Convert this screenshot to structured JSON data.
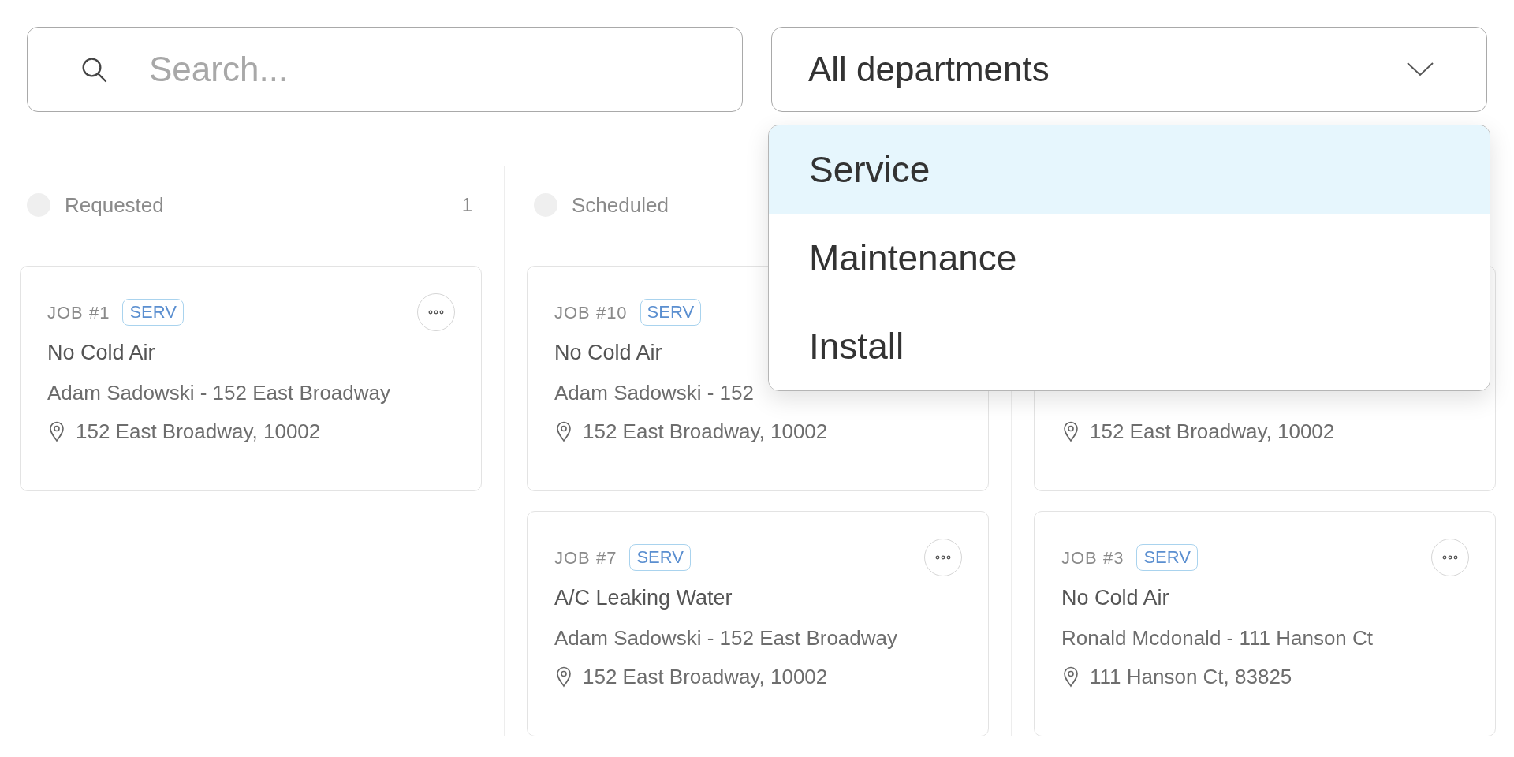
{
  "search": {
    "placeholder": "Search..."
  },
  "department_select": {
    "value": "All departments",
    "expanded": true,
    "options": [
      {
        "label": "Service",
        "selected": true
      },
      {
        "label": "Maintenance",
        "selected": false
      },
      {
        "label": "Install",
        "selected": false
      }
    ]
  },
  "columns": [
    {
      "title": "Requested",
      "count": "1",
      "cards": [
        {
          "job": "JOB #1",
          "tag": "SERV",
          "menu": true,
          "title": "No Cold Air",
          "customer": "Adam Sadowski - 152 East Broadway",
          "location": "152 East Broadway, 10002"
        }
      ]
    },
    {
      "title": "Scheduled",
      "cards": [
        {
          "job": "JOB #10",
          "tag": "SERV",
          "title": "No Cold Air",
          "customer": "Adam Sadowski - 152",
          "location": "152 East Broadway, 10002"
        },
        {
          "job": "JOB #7",
          "tag": "SERV",
          "menu": true,
          "title": "A/C Leaking Water",
          "customer": "Adam Sadowski - 152 East Broadway",
          "location": "152 East Broadway, 10002"
        }
      ]
    },
    {
      "cards": [
        {
          "location": "152 East Broadway, 10002"
        },
        {
          "job": "JOB #3",
          "tag": "SERV",
          "menu": true,
          "title": "No Cold Air",
          "customer": "Ronald Mcdonald - 111 Hanson Ct",
          "location": "111 Hanson Ct, 83825"
        }
      ]
    }
  ]
}
